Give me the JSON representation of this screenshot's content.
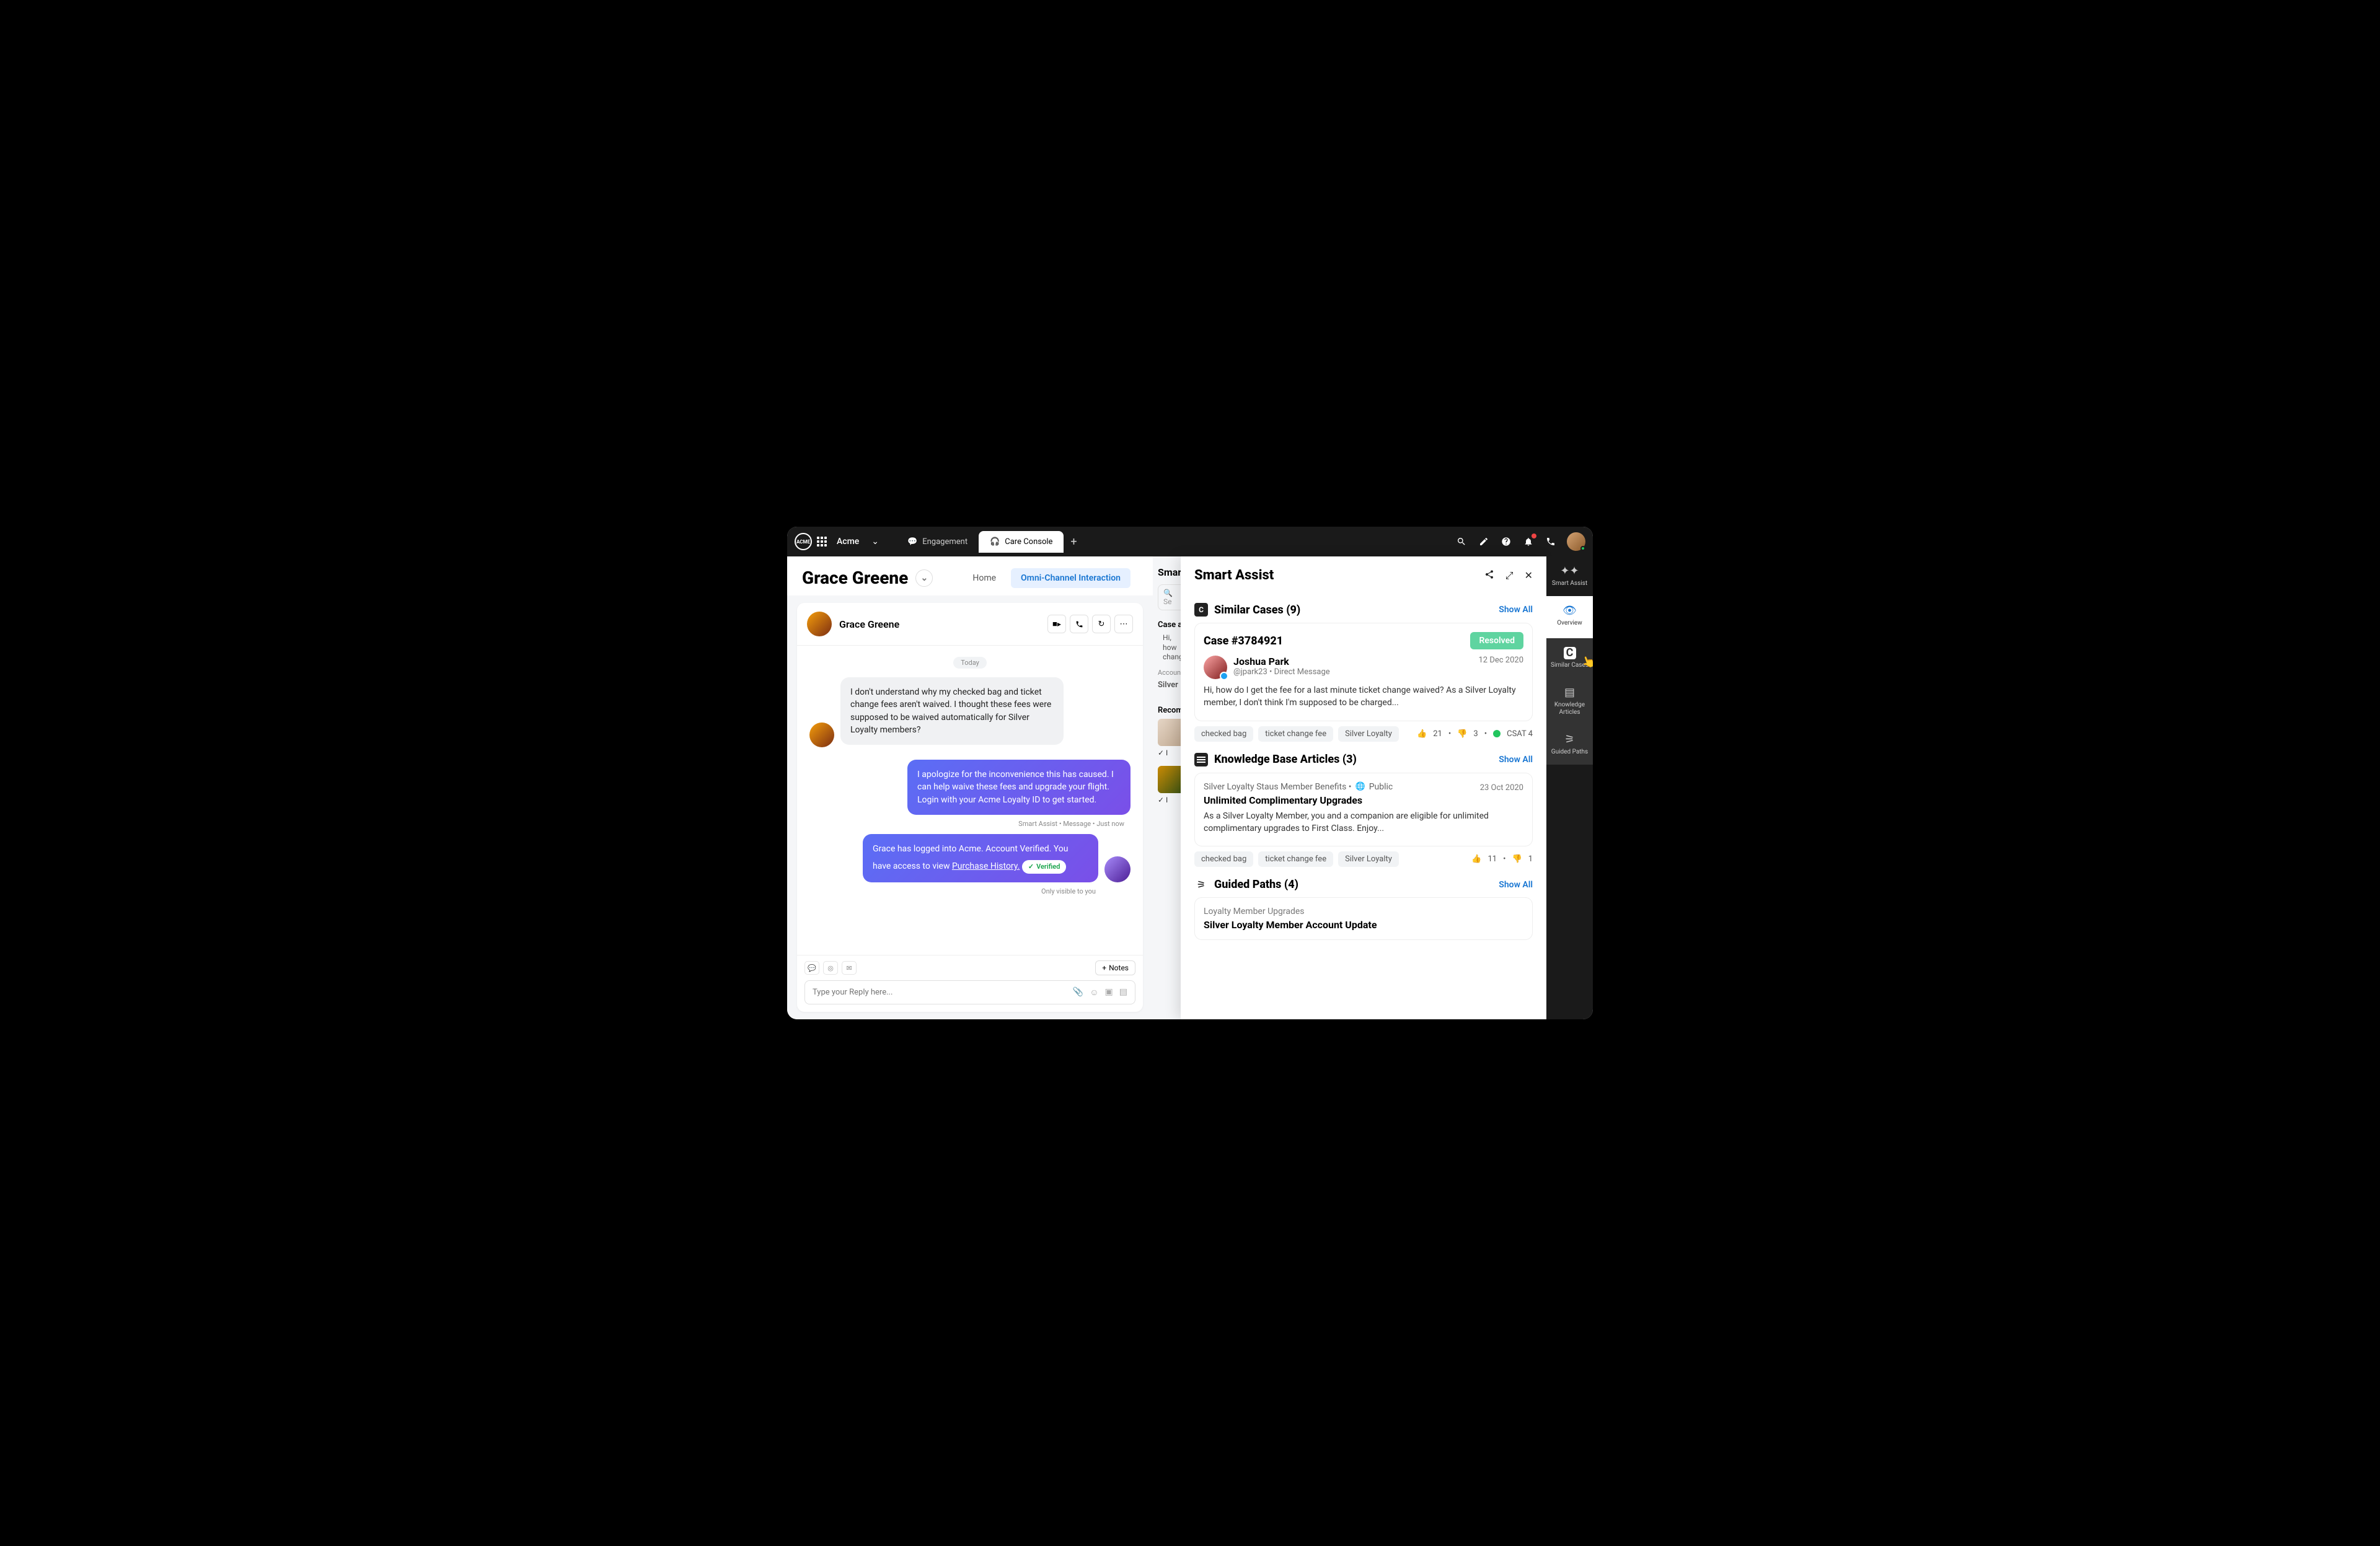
{
  "topbar": {
    "logo_text": "ACME",
    "org_name": "Acme",
    "tabs": [
      {
        "label": "Engagement",
        "active": false
      },
      {
        "label": "Care Console",
        "active": true
      }
    ]
  },
  "page": {
    "title": "Grace Greene",
    "subtabs": [
      {
        "label": "Home",
        "active": false
      },
      {
        "label": "Omni-Channel Interaction",
        "active": true
      }
    ]
  },
  "chat": {
    "contact_name": "Grace Greene",
    "date_label": "Today",
    "messages": {
      "m1": "I don't understand why my checked bag and ticket change fees aren't waived.  I thought these fees were supposed to be waived automatically for Silver Loyalty members?",
      "m2": "I apologize for the inconvenience this has caused. I can help waive these fees and upgrade your flight. Login with your Acme Loyalty ID to get started.",
      "m2_meta": "Smart Assist • Message • Just now",
      "m3_pre": "Grace has logged into Acme. Account Verified. You have access to view ",
      "m3_link": "Purchase History.",
      "m3_badge": "Verified",
      "m3_visibility": "Only visible to you"
    },
    "reply_placeholder": "Type your Reply here...",
    "notes_label": "Notes"
  },
  "middle": {
    "title": "Smart",
    "search_placeholder": "Se",
    "case_label": "Case a",
    "case_preview": "Hi, how",
    "case_preview2": "change",
    "account_label": "Accoun",
    "account_value": "Silver I",
    "recom_label": "Recom",
    "insert_label": "I"
  },
  "panel": {
    "title": "Smart Assist",
    "similar": {
      "heading": "Similar Cases (9)",
      "show_all": "Show All",
      "case": {
        "id": "Case #3784921",
        "status": "Resolved",
        "user_name": "Joshua Park",
        "handle": "@jpark23 • Direct Message",
        "date": "12 Dec 2020",
        "body": "Hi, how do I get the fee for a last minute ticket change waived? As a Silver Loyalty member, I don't think I'm supposed to be charged...",
        "tags": [
          "checked bag",
          "ticket change fee",
          "Silver Loyalty"
        ],
        "up": "21",
        "down": "3",
        "csat": "CSAT 4"
      }
    },
    "kb": {
      "heading": "Knowledge Base Articles (3)",
      "show_all": "Show All",
      "article": {
        "breadcrumb": "Silver Loyalty Staus Member Benefits •",
        "visibility": "Public",
        "date": "23 Oct 2020",
        "title": "Unlimited Complimentary Upgrades",
        "body": "As a Silver Loyalty Member, you and a companion are eligible for unlimited complimentary upgrades to First Class. Enjoy...",
        "tags": [
          "checked bag",
          "ticket change fee",
          "Silver Loyalty"
        ],
        "up": "11",
        "down": "1"
      }
    },
    "guided": {
      "heading": "Guided Paths (4)",
      "show_all": "Show All",
      "path": {
        "crumb": "Loyalty Member Upgrades",
        "title": "Silver Loyalty Member Account Update"
      }
    }
  },
  "rail": {
    "items": [
      {
        "label": "Smart Assist"
      },
      {
        "label": "Overview"
      },
      {
        "label": "Similar Cases"
      },
      {
        "label": "Knowledge Articles"
      },
      {
        "label": "Guided Paths"
      }
    ]
  }
}
